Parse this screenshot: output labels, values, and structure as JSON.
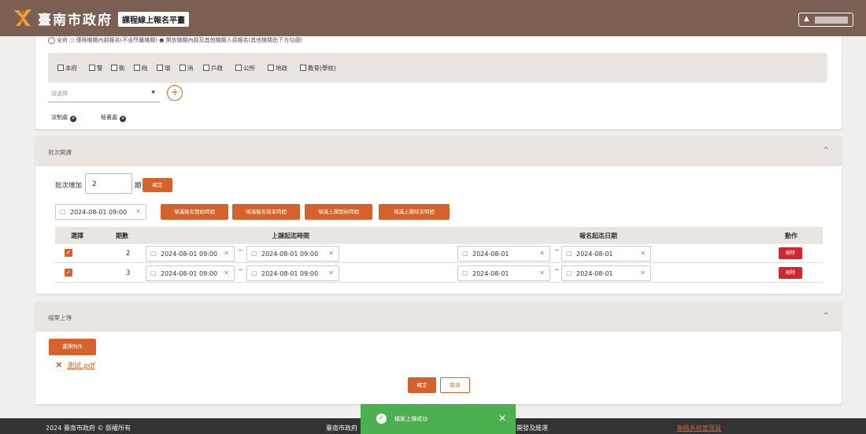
{
  "header": {
    "site_title": "臺南市政府",
    "platform_name": "課程線上報名平臺",
    "user_icon": "user-icon",
    "accent_color": "#7a5f52"
  },
  "org_section": {
    "radio_text": "全府 ○ 僅限機關內部報名(不含所屬機關) ● 開放機關內部及其他機關人員報名(其他機關由下方勾選)",
    "org_options": [
      "本府",
      "警",
      "衛",
      "稅",
      "環",
      "消",
      "戶政",
      "公所",
      "地政",
      "教育(學校)"
    ],
    "select_placeholder": "請選擇",
    "add_icon": "plus-icon",
    "chips": [
      "法制處",
      "秘書處"
    ]
  },
  "batch_section": {
    "title": "批次開課",
    "add_label": "批次增加",
    "add_value": "2",
    "unit": "期",
    "confirm_label": "確定",
    "base_date": "2024-08-01 09:00",
    "fill_buttons": [
      "填滿報名開始時間",
      "填滿報名結束時間",
      "填滿上課開始時間",
      "填滿上課結束時間"
    ],
    "columns": [
      "選擇",
      "期數",
      "上課起迄時間",
      "報名起迄日期",
      "動作"
    ],
    "rows": [
      {
        "period": "2",
        "class_start": "2024-08-01 09:00",
        "class_end": "2024-08-01 09:00",
        "reg_start": "2024-08-01",
        "reg_end": "2024-08-01",
        "action": "刪除"
      },
      {
        "period": "3",
        "class_start": "2024-08-01 09:00",
        "class_end": "2024-08-01 09:00",
        "reg_start": "2024-08-01",
        "reg_end": "2024-08-01",
        "action": "刪除"
      }
    ]
  },
  "upload_section": {
    "title": "檔案上傳",
    "choose_label": "選擇附件",
    "file_name": "測試.pdf",
    "confirm_label": "確定",
    "cancel_label": "取消"
  },
  "footer": {
    "copyright": "2024 臺南市政府 © 版權所有",
    "center_prefix": "臺南市政府",
    "center_suffix": "開發及維運",
    "contact_link": "聯絡系統管理員"
  },
  "toast": {
    "message": "檔案上傳成功",
    "color": "#4caf50"
  }
}
